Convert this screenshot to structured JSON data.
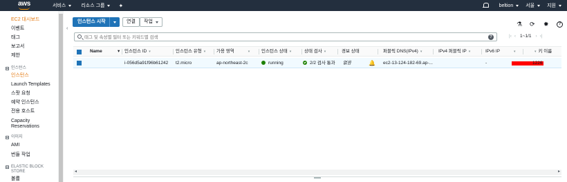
{
  "header": {
    "logo_text": "aws",
    "nav": [
      {
        "label": "서비스"
      },
      {
        "label": "리소스 그룹"
      }
    ],
    "pin_icon": "pin-icon",
    "user_label": "beltion",
    "region_label": "서울",
    "support_label": "지원",
    "colors": {
      "bar": "#232f3e",
      "accent": "#ff9900"
    }
  },
  "sidebar": {
    "items": [
      {
        "label": "EC2 대시보드",
        "active": true
      },
      {
        "label": "이벤트"
      },
      {
        "label": "태그"
      },
      {
        "label": "보고서"
      },
      {
        "label": "제한"
      }
    ],
    "sections": [
      {
        "title": "인스턴스",
        "items": [
          {
            "label": "인스턴스",
            "active": true
          },
          {
            "label": "Launch Templates"
          },
          {
            "label": "스팟 요청"
          },
          {
            "label": "예약 인스턴스"
          },
          {
            "label": "전용 호스트"
          },
          {
            "label": "Capacity Reservations"
          }
        ]
      },
      {
        "title": "이미지",
        "items": [
          {
            "label": "AMI"
          },
          {
            "label": "번들 작업"
          }
        ]
      },
      {
        "title": "ELASTIC BLOCK STORE",
        "items": [
          {
            "label": "볼륨"
          }
        ]
      }
    ]
  },
  "toolbar": {
    "launch_label": "인스턴스 시작",
    "connect_label": "연결",
    "actions_label": "작업",
    "icons": [
      "flask-icon",
      "refresh-icon",
      "settings-icon",
      "help-icon"
    ]
  },
  "search": {
    "placeholder": "태그 및 속성별 필터 또는 키워드별 검색",
    "help": "?"
  },
  "pagination": {
    "range": "1~1/1"
  },
  "table": {
    "columns": [
      "Name",
      "인스턴스 ID",
      "인스턴스 유형",
      "가용 영역",
      "인스턴스 상태",
      "상태 검사",
      "경보 상태",
      "퍼블릭 DNS(IPv4)",
      "IPv4 퍼블릭 IP",
      "IPv6 IP",
      "키 이름"
    ],
    "rows": [
      {
        "name": "",
        "instance_id": "i-056d5a91f96b61242",
        "type": "t2.micro",
        "zone": "ap-northeast-2c",
        "state": "running",
        "state_color": "#1d8102",
        "status_check": "2/2 검사 통과",
        "alarm": "없음",
        "public_dns": "ec2-13-124-182-69.ap-...",
        "public_ip": "",
        "ipv6": "-",
        "key_name": "1226"
      }
    ]
  }
}
